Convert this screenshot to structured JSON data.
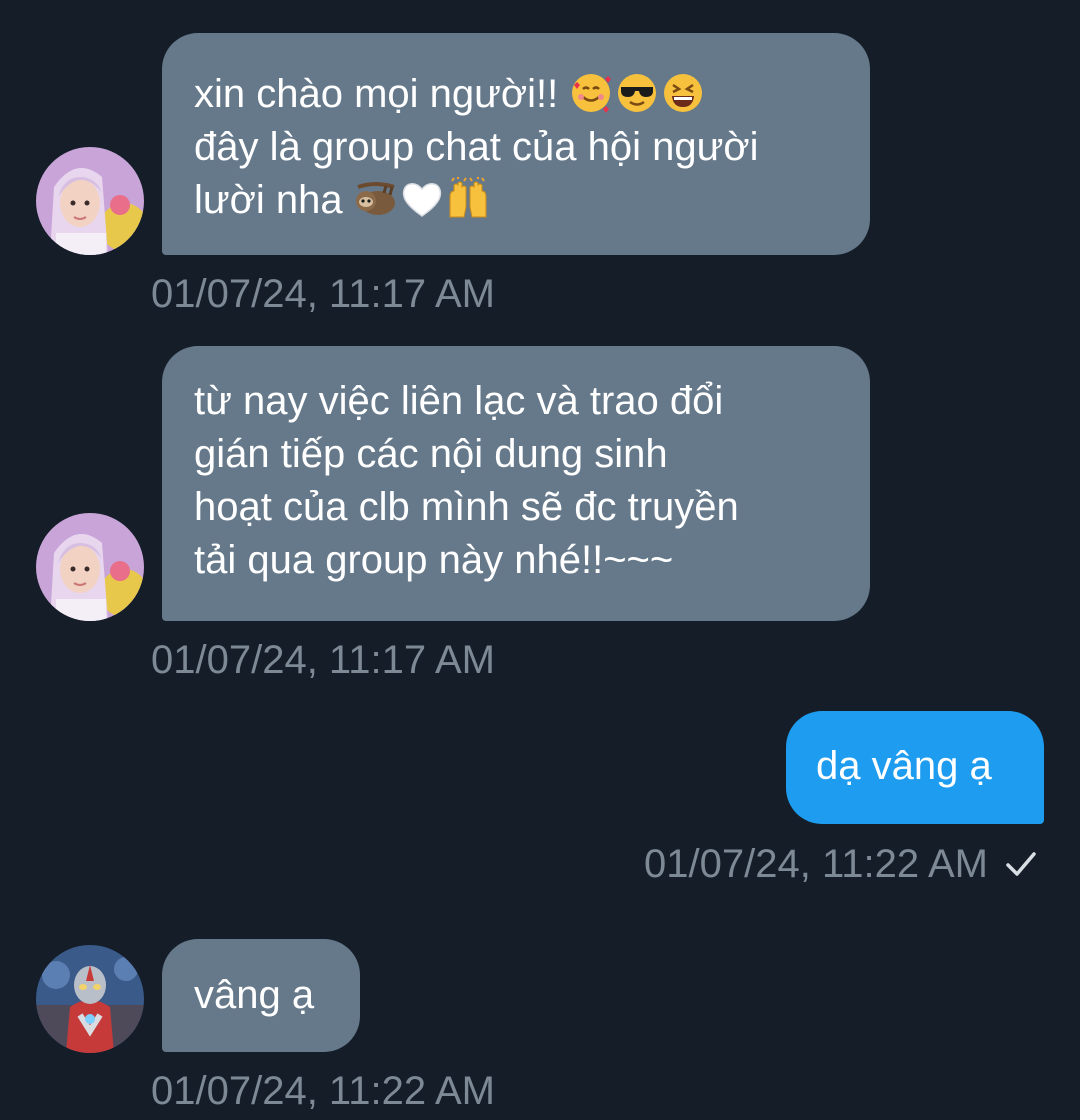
{
  "messages": [
    {
      "lines": [
        "xin chào mọi người!!",
        "đây là group chat của hội người",
        "lười nha"
      ],
      "emojis": [
        "smiling-face-with-hearts",
        "smiling-face-with-sunglasses",
        "grinning-squinting-face",
        "sloth",
        "white-heart",
        "raising-hands"
      ],
      "timestamp": "01/07/24, 11:17 AM",
      "direction": "incoming"
    },
    {
      "lines": [
        "từ nay việc liên lạc và trao đổi",
        "gián tiếp các nội dung sinh",
        "hoạt của clb mình sẽ đc truyền",
        "tải qua group này nhé!!~~~"
      ],
      "timestamp": "01/07/24, 11:17 AM",
      "direction": "incoming"
    },
    {
      "text": "dạ vâng ạ",
      "timestamp": "01/07/24, 11:22 AM",
      "status_icon": "check-icon",
      "direction": "outgoing"
    },
    {
      "text": "vâng ạ",
      "timestamp": "01/07/24, 11:22 AM",
      "direction": "incoming"
    }
  ],
  "colors": {
    "background": "#151e28",
    "incoming_bubble": "#66798b",
    "outgoing_bubble": "#1e9cf0",
    "timestamp": "#7d8995",
    "message_text": "#ffffff"
  }
}
